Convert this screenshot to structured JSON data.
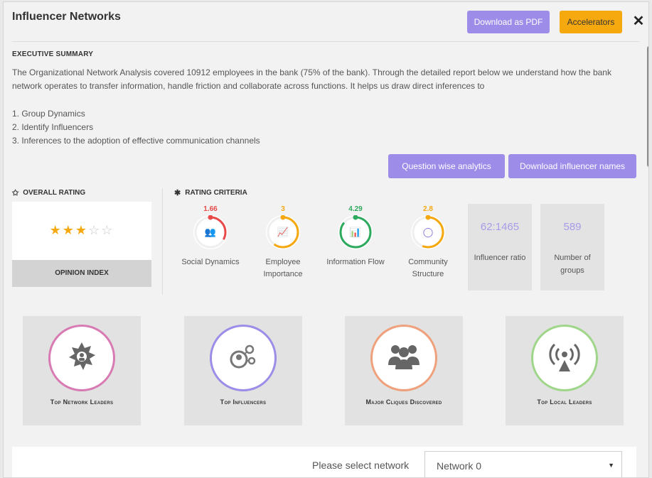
{
  "header": {
    "title": "Influencer Networks",
    "download_pdf": "Download as PDF",
    "accelerators": "Accelerators",
    "close": "✕"
  },
  "summary": {
    "heading": "EXECUTIVE SUMMARY",
    "text": "The Organizational Network Analysis covered 10912 employees in the bank (75% of the bank). Through the detailed report below we understand how the bank network operates to transfer information, handle friction and collaborate across functions. It helps us draw direct inferences to",
    "list": [
      "1. Group Dynamics",
      "2. Identify Influencers",
      "3. Inferences to the adoption of effective communication channels"
    ]
  },
  "actions": {
    "question_wise": "Question wise analytics",
    "download_influencers": "Download influencer names"
  },
  "overall_rating": {
    "heading": "OVERALL RATING",
    "stars_filled": 3,
    "stars_total": 5,
    "footer": "OPINION INDEX"
  },
  "rating_criteria": {
    "heading": "RATING CRITERIA",
    "items": [
      {
        "value": "1.66",
        "label_line1": "Social Dynamics",
        "label_line2": "",
        "color": "#e84a4a",
        "fraction": 0.33,
        "icon": "people-icon"
      },
      {
        "value": "3",
        "label_line1": "Employee",
        "label_line2": "Importance",
        "color": "#f6a80f",
        "fraction": 0.6,
        "icon": "trend-chart-icon"
      },
      {
        "value": "4.29",
        "label_line1": "Information Flow",
        "label_line2": "",
        "color": "#2eaa5e",
        "fraction": 0.86,
        "icon": "bar-chart-icon"
      },
      {
        "value": "2.8",
        "label_line1": "Community",
        "label_line2": "Structure",
        "color": "#f6a80f",
        "fraction": 0.56,
        "icon": "ring-icon"
      }
    ]
  },
  "stats": [
    {
      "value": "62:1465",
      "label_line1": "Influencer ratio",
      "label_line2": ""
    },
    {
      "value": "589",
      "label_line1": "Number of",
      "label_line2": "groups"
    }
  ],
  "tiles": [
    {
      "label": "Top Network Leaders",
      "ring_color": "#d97bb3",
      "icon": "network-leader-icon"
    },
    {
      "label": "Top Influencers",
      "ring_color": "#9d8ce8",
      "icon": "influencer-icon"
    },
    {
      "label": "Major Cliques Discovered",
      "ring_color": "#f0a07a",
      "icon": "group-icon"
    },
    {
      "label": "Top Local Leaders",
      "ring_color": "#9fd68a",
      "icon": "broadcast-icon"
    }
  ],
  "network_select": {
    "label": "Please select network",
    "value": "Network 0"
  }
}
